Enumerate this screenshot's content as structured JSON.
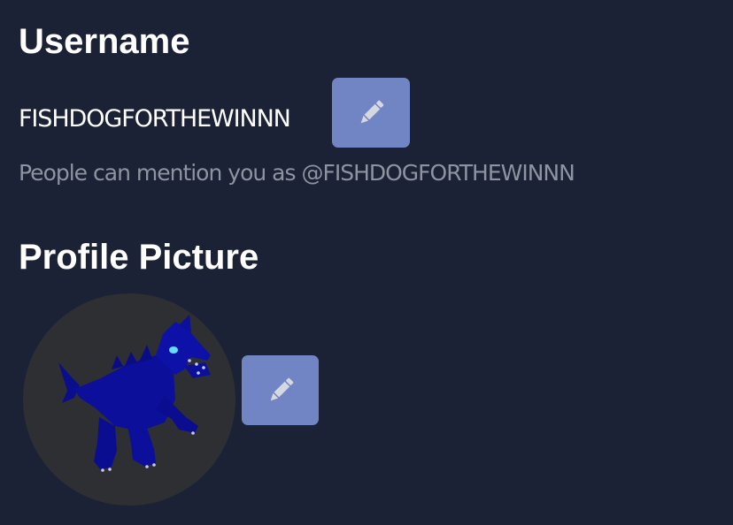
{
  "username_section": {
    "heading": "Username",
    "value": "FISHDOGFORTHEWINNN",
    "helper": "People can mention you as @FISHDOGFORTHEWINNN",
    "edit_icon": "pencil-icon"
  },
  "profile_picture_section": {
    "heading": "Profile Picture",
    "avatar_subject": "blue dragon creature",
    "edit_icon": "pencil-icon"
  },
  "colors": {
    "background": "#1c2235",
    "button": "#7185c4",
    "icon": "#d6d8df",
    "helper_text": "#8e93a1",
    "avatar_bg": "#2e2f33",
    "creature": "#0b0f9a"
  }
}
